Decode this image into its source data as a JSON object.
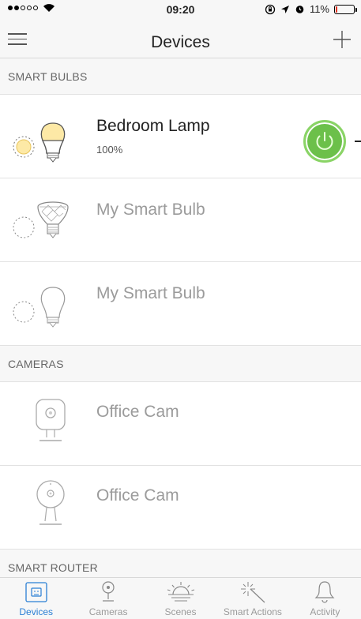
{
  "status_bar": {
    "time": "09:20",
    "battery_percent": "11%",
    "battery_level": 0.11,
    "signal_bars_filled": 2,
    "signal_bars_total": 5
  },
  "nav": {
    "title": "Devices"
  },
  "sections": [
    {
      "title": "SMART BULBS",
      "devices": [
        {
          "name": "Bedroom Lamp",
          "status": "100%",
          "on": true,
          "icon": "bulb-icon"
        },
        {
          "name": "My Smart Bulb",
          "status": "",
          "on": false,
          "icon": "flood-bulb-icon"
        },
        {
          "name": "My Smart Bulb",
          "status": "",
          "on": false,
          "icon": "bulb-icon"
        }
      ]
    },
    {
      "title": "CAMERAS",
      "devices": [
        {
          "name": "Office Cam",
          "on": false,
          "icon": "camera-icon"
        },
        {
          "name": "Office Cam",
          "on": false,
          "icon": "round-camera-icon"
        }
      ]
    },
    {
      "title": "SMART ROUTER",
      "devices": []
    }
  ],
  "tabs": [
    {
      "label": "Devices",
      "icon": "devices-icon",
      "active": true
    },
    {
      "label": "Cameras",
      "icon": "camera-tab-icon",
      "active": false
    },
    {
      "label": "Scenes",
      "icon": "sunrise-icon",
      "active": false
    },
    {
      "label": "Smart Actions",
      "icon": "magic-wand-icon",
      "active": false
    },
    {
      "label": "Activity",
      "icon": "bell-icon",
      "active": false
    }
  ],
  "colors": {
    "power_on": "#6cc04a",
    "bulb_lit": "#fde9a6",
    "active_tab": "#2a7fd4",
    "battery_low": "#e0301e"
  }
}
